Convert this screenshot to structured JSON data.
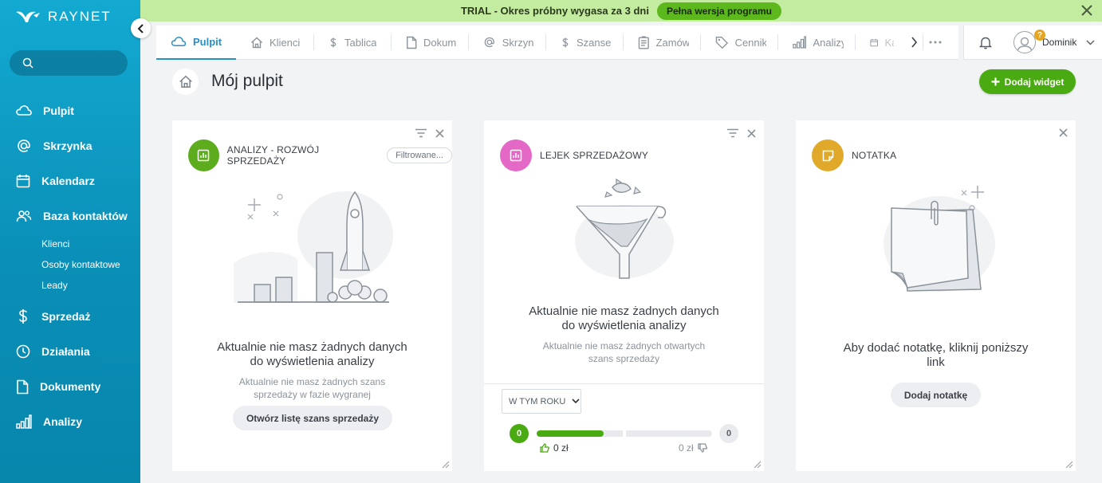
{
  "brand": {
    "name": "RAYNET"
  },
  "search": {
    "placeholder": ""
  },
  "sidebar": {
    "items": [
      {
        "label": "Pulpit"
      },
      {
        "label": "Skrzynka"
      },
      {
        "label": "Kalendarz"
      },
      {
        "label": "Baza kontaktów"
      },
      {
        "label": "Sprzedaż"
      },
      {
        "label": "Działania"
      },
      {
        "label": "Dokumenty"
      },
      {
        "label": "Analizy"
      }
    ],
    "sub_items": [
      {
        "label": "Klienci"
      },
      {
        "label": "Osoby kontaktowe"
      },
      {
        "label": "Leady"
      }
    ]
  },
  "trial": {
    "text": "TRIAL - Okres próbny wygasa za 3 dni",
    "button": "Pełna wersja programu"
  },
  "tabs": [
    {
      "label": "Pulpit",
      "icon": "cloud-icon"
    },
    {
      "label": "Klienci",
      "icon": "home-icon"
    },
    {
      "label": "Tablica",
      "icon": "dollar-icon"
    },
    {
      "label": "Dokum",
      "icon": "document-icon"
    },
    {
      "label": "Skrzynk",
      "icon": "at-icon"
    },
    {
      "label": "Szanse",
      "icon": "dollar-icon"
    },
    {
      "label": "Zamów",
      "icon": "order-icon"
    },
    {
      "label": "Cennik",
      "icon": "tag-icon"
    },
    {
      "label": "Analizy",
      "icon": "bar-chart-icon"
    },
    {
      "label": "Kal",
      "icon": "calendar-icon"
    }
  ],
  "user": {
    "name": "Dominik"
  },
  "page": {
    "title": "Mój pulpit",
    "add_widget": "Dodaj widget"
  },
  "widgets": {
    "analytics": {
      "title": "ANALIZY - ROZWÓJ SPRZEDAŻY",
      "filter": "Filtrowane...",
      "empty_line1": "Aktualnie nie masz żadnych danych",
      "empty_line2": "do wyświetlenia analizy",
      "sub_line1": "Aktualnie nie masz żadnych szans",
      "sub_line2": "sprzedaży w fazie wygranej",
      "button": "Otwórz listę szans sprzedaży",
      "color": "#5cac1e"
    },
    "funnel": {
      "title": "LEJEK SPRZEDAŻOWY",
      "empty_line1": "Aktualnie nie masz żadnych danych",
      "empty_line2": "do wyświetlenia analizy",
      "sub_line1": "Aktualnie nie masz żadnych otwartych",
      "sub_line2": "szans sprzedaży",
      "period": "W TYM ROKU",
      "won_count": "0",
      "lost_count": "0",
      "won_amount": "0 zł",
      "lost_amount": "0 zł",
      "won_fraction": 0.38,
      "color": "#e468c6"
    },
    "note": {
      "title": "NOTATKA",
      "text_line1": "Aby dodać notatkę, kliknij poniższy",
      "text_line2": "link",
      "button": "Dodaj notatkę",
      "color": "#e0a92a"
    }
  }
}
